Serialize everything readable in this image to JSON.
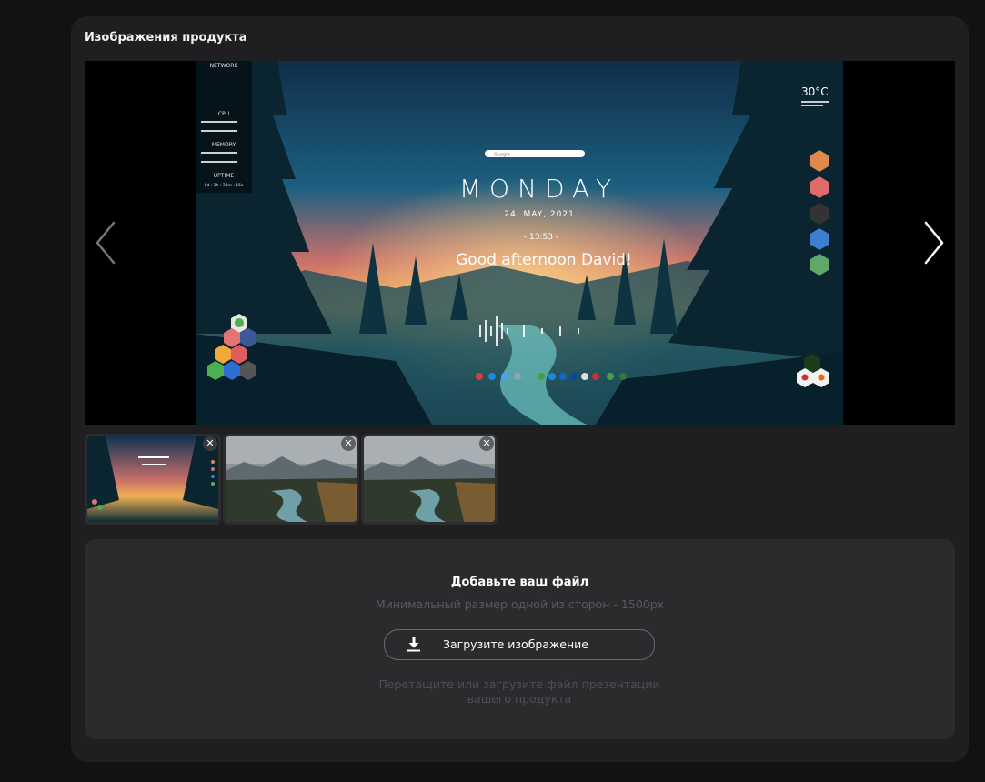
{
  "panel": {
    "title": "Изображения продукта"
  },
  "viewer": {
    "prev_icon": "chevron-left-icon",
    "next_icon": "chevron-right-icon",
    "wallpaper": {
      "network_label": "NETWORK",
      "cpu_label": "CPU",
      "memory_label": "MEMORY",
      "uptime_label": "UPTIME",
      "uptime_value": "0d : 1h : 33m : 15s",
      "day": "MONDAY",
      "date": "24. MAY, 2021.",
      "time": "- 13:53 -",
      "greeting": "Good afternoon David!",
      "temperature": "30°C",
      "search_placeholder": "Google"
    }
  },
  "thumbnails": [
    {
      "name": "monday-wallpaper",
      "close_icon": "close-icon"
    },
    {
      "name": "mountain-river",
      "close_icon": "close-icon"
    },
    {
      "name": "mountain-river",
      "close_icon": "close-icon"
    }
  ],
  "thumb_close_glyph": "✕",
  "upload": {
    "title": "Добавьте ваш файл",
    "subtitle": "Минимальный размер одной из сторон - 1500px",
    "button_label": "Загрузите изображение",
    "button_icon": "download-icon",
    "hint": "Перетащите или загрузите файл презентации вашего продукта"
  }
}
